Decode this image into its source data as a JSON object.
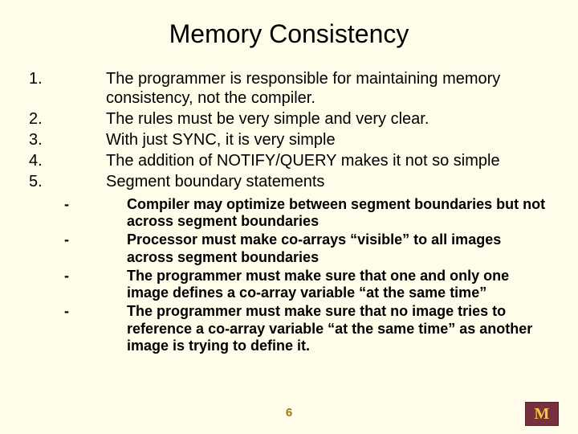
{
  "title": "Memory Consistency",
  "items": [
    {
      "n": "1.",
      "t": "The programmer is responsible for maintaining memory consistency, not the compiler."
    },
    {
      "n": "2.",
      "t": "The rules must be very simple and very clear."
    },
    {
      "n": "3.",
      "t": "With just SYNC, it is very simple"
    },
    {
      "n": "4.",
      "t": "The addition of NOTIFY/QUERY makes it not so simple"
    },
    {
      "n": "5.",
      "t": "Segment boundary statements"
    }
  ],
  "subitems": [
    {
      "d": "-",
      "t": "Compiler may optimize between segment boundaries but not across segment boundaries"
    },
    {
      "d": "-",
      "t": "Processor must make co-arrays “visible” to all images across segment boundaries"
    },
    {
      "d": "-",
      "t": "The programmer must make sure that one and only one image defines a co-array variable “at the same time”"
    },
    {
      "d": "-",
      "t": "The programmer must make sure that no image tries to reference a co-array variable “at the same time” as another image is trying to define it."
    }
  ],
  "page": "6",
  "logo_letter": "M"
}
